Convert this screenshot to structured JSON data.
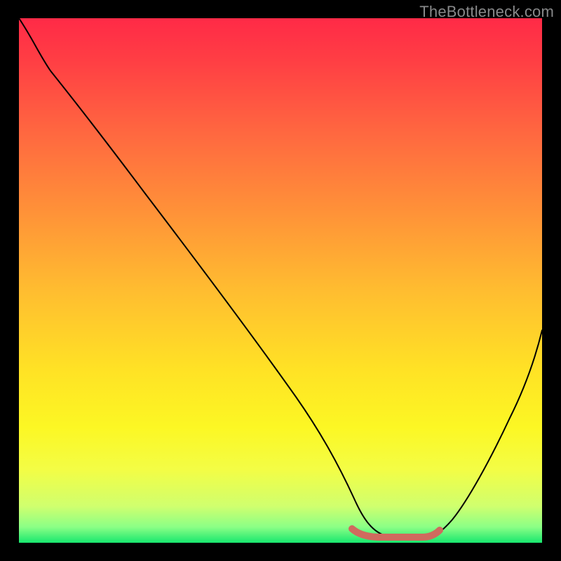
{
  "watermark": "TheBottleneck.com",
  "colors": {
    "page_bg": "#000000",
    "gradient_top": "#ff2a47",
    "gradient_bottom": "#18e76e",
    "curve_stroke": "#000000",
    "floor_stroke": "#d06a5e",
    "watermark_text": "#88898a"
  },
  "chart_data": {
    "type": "line",
    "title": "",
    "xlabel": "",
    "ylabel": "",
    "xlim": [
      0,
      100
    ],
    "ylim": [
      0,
      100
    ],
    "series": [
      {
        "name": "curve",
        "x": [
          0,
          4,
          10,
          20,
          30,
          40,
          50,
          56,
          60,
          63,
          66,
          70,
          74,
          77,
          80,
          85,
          90,
          95,
          100
        ],
        "y": [
          100,
          96,
          90,
          77,
          64,
          51,
          38,
          30,
          21,
          13,
          7,
          3,
          1.2,
          1.0,
          1.2,
          5,
          15,
          28,
          42
        ]
      }
    ],
    "floor_segment": {
      "x_start": 63,
      "x_end": 79,
      "y": 1.1
    },
    "grid": false,
    "legend": false
  }
}
